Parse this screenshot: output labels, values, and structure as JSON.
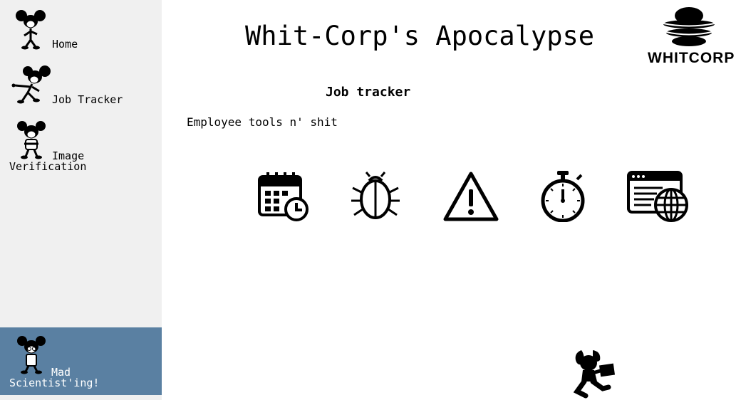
{
  "sidebar": {
    "items": [
      {
        "label": "Home",
        "icon": "cartoon-mascot-icon",
        "active": false
      },
      {
        "label": "Job Tracker",
        "icon": "cartoon-mascot-pointing-icon",
        "active": false
      },
      {
        "label": "Image\nVerification",
        "icon": "cartoon-mascot-arms-crossed-icon",
        "active": false
      },
      {
        "label": "Mad\nScientist'ing!",
        "icon": "cartoon-mascot-glasses-icon",
        "active": true
      }
    ],
    "active_color": "#5a80a2",
    "background_color": "#f0f0f0"
  },
  "header": {
    "title": "Whit-Corp's Apocalypse",
    "logo_text": "WHITCORP"
  },
  "main": {
    "section_title": "Job tracker",
    "subtitle": "Employee tools n' shit",
    "tools": [
      {
        "icon": "calendar-clock-icon"
      },
      {
        "icon": "bug-icon"
      },
      {
        "icon": "warning-icon"
      },
      {
        "icon": "stopwatch-icon"
      },
      {
        "icon": "web-globe-icon"
      }
    ]
  },
  "decoration": {
    "icon": "mascot-silhouette-icon"
  }
}
